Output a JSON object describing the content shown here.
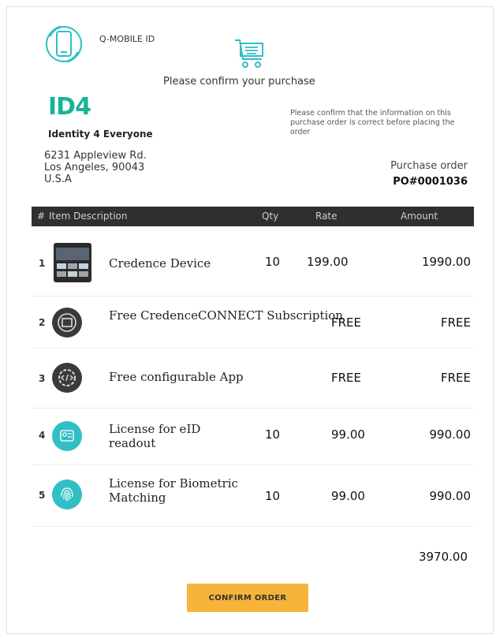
{
  "header": {
    "app_name": "Q-MOBILE ID",
    "confirm_prompt": "Please confirm your purchase"
  },
  "company": {
    "brand": "ID4",
    "tagline": "Identity 4 Everyone",
    "address": [
      "6231 Appleview Rd.",
      "Los Angeles, 90043",
      "U.S.A"
    ]
  },
  "note": "Please confirm that the information on this purchase order is correct before placing the order",
  "purchase_order": {
    "label": "Purchase order",
    "number": "PO#0001036"
  },
  "table": {
    "headers": {
      "num": "#",
      "description": "Item Description",
      "qty": "Qty",
      "rate": "Rate",
      "amount": "Amount"
    },
    "rows": [
      {
        "num": "1",
        "description": "Credence Device",
        "qty": "10",
        "rate": "199.00",
        "amount": "1990.00",
        "icon": "device-image"
      },
      {
        "num": "2",
        "description": "Free CredenceCONNECT Subscription",
        "qty": "",
        "rate": "FREE",
        "amount": "FREE",
        "icon": "subscription-icon"
      },
      {
        "num": "3",
        "description": "Free configurable App",
        "qty": "",
        "rate": "FREE",
        "amount": "FREE",
        "icon": "code-gear-icon"
      },
      {
        "num": "4",
        "description": "License for eID readout",
        "qty": "10",
        "rate": "99.00",
        "amount": "990.00",
        "icon": "eid-license-icon"
      },
      {
        "num": "5",
        "description": "License for Biometric Matching",
        "qty": "10",
        "rate": "99.00",
        "amount": "990.00",
        "icon": "fingerprint-icon"
      }
    ]
  },
  "total": "3970.00",
  "confirm_button": "CONFIRM ORDER",
  "colors": {
    "brand": "#18b39a",
    "button": "#f7b43a",
    "header_bar": "#2f2f2f",
    "icon_teal": "#2fbfc4"
  }
}
